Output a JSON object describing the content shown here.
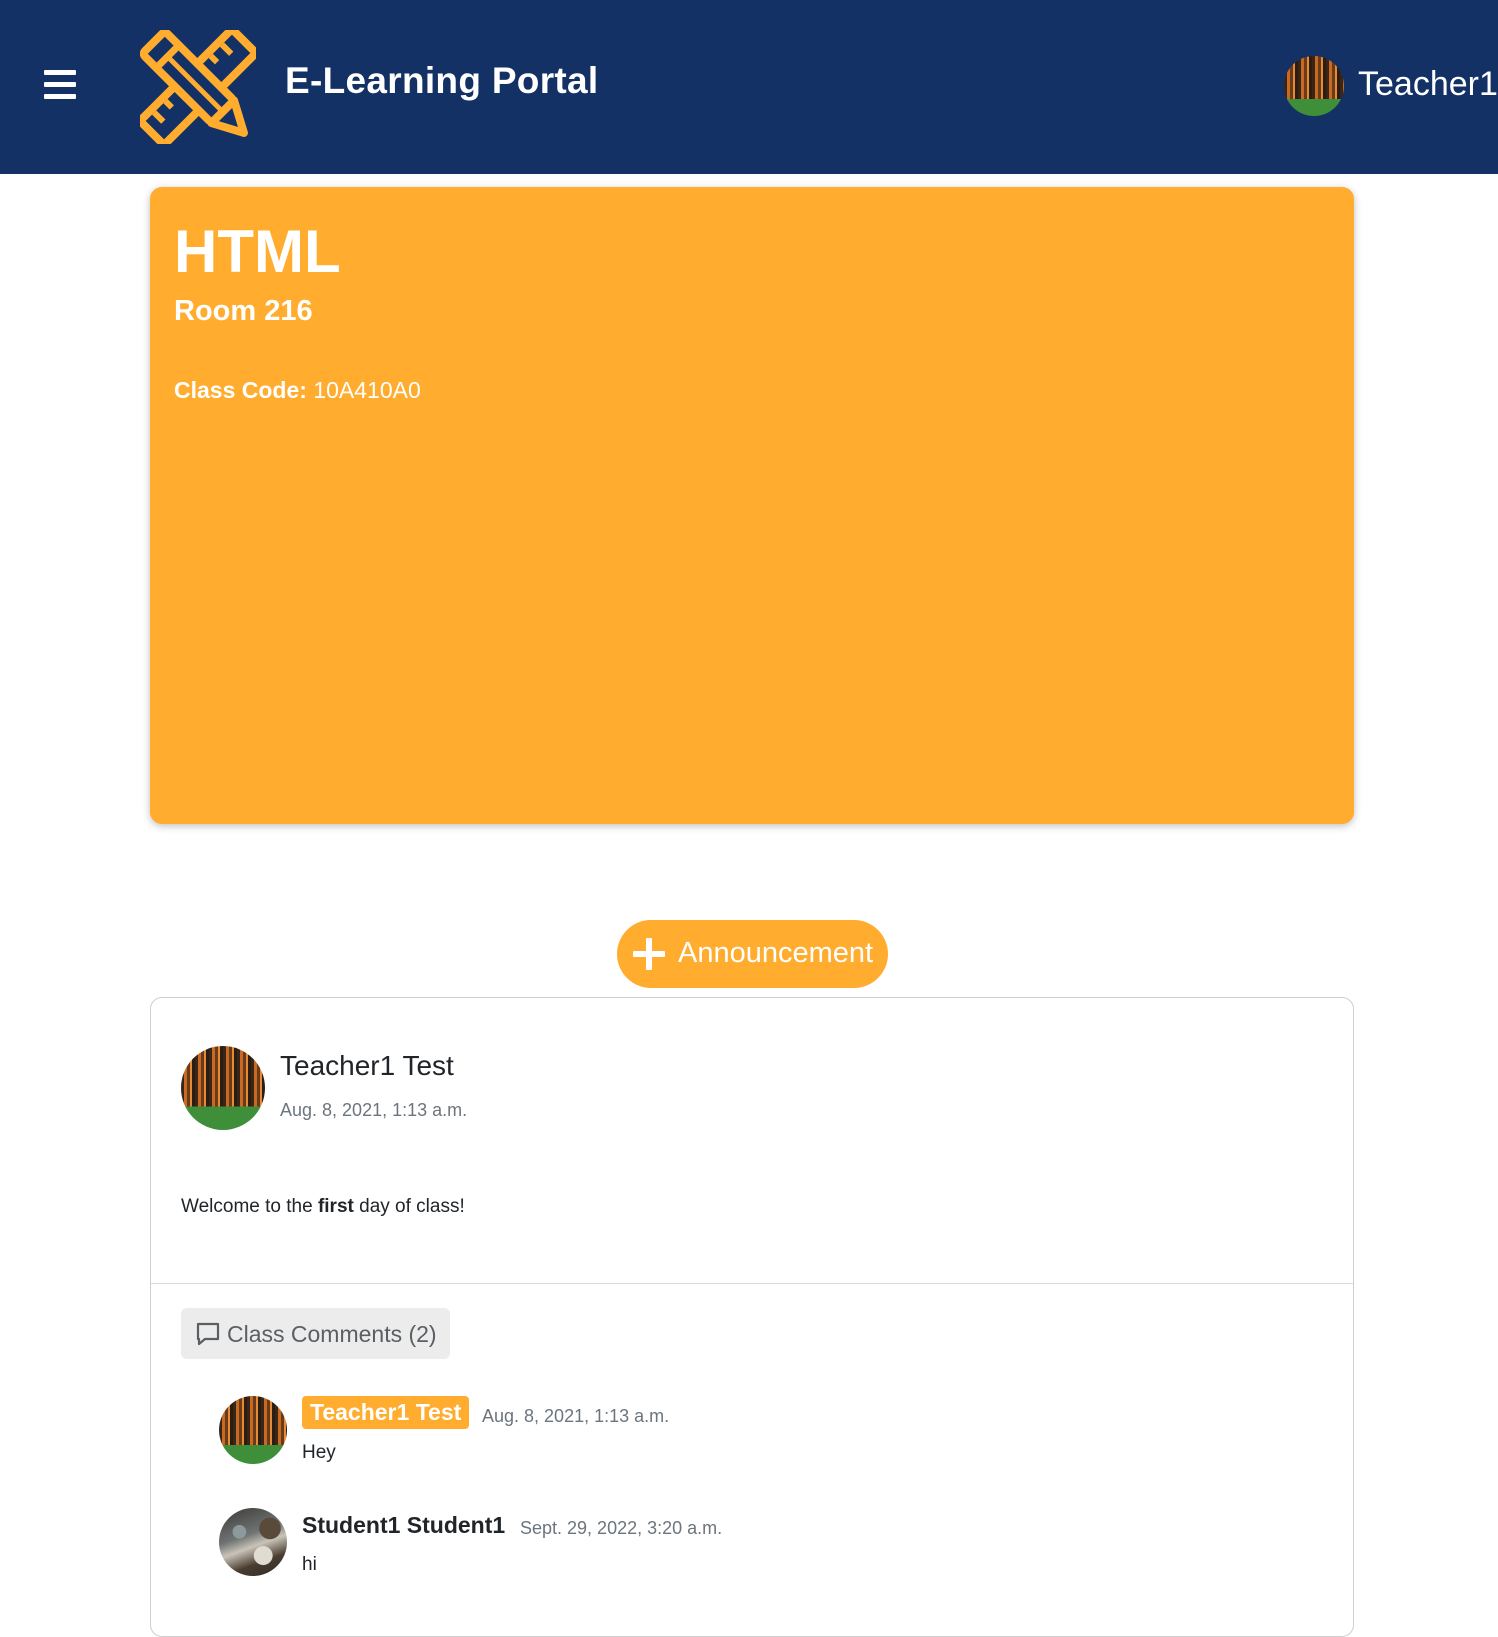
{
  "header": {
    "brand": "E-Learning Portal",
    "user_name": "Teacher1",
    "menu_icon": "hamburger-menu-icon",
    "logo_icon": "pencil-ruler-icon",
    "background_color": "#143166",
    "logo_color": "#ffac2f"
  },
  "class": {
    "name": "HTML",
    "room": "Room 216",
    "code_label": "Class Code:",
    "code_value": "10A410A0",
    "banner_color": "#ffac2f"
  },
  "announcement_button": {
    "icon": "plus-icon",
    "label": "Announcement"
  },
  "post": {
    "author": "Teacher1 Test",
    "date": "Aug. 8, 2021, 1:13 a.m.",
    "body_before": "Welcome to the ",
    "body_bold": "first",
    "body_after": " day of class!",
    "comments_toggle_label": "Class Comments (2)",
    "comments_icon": "speech-bubble-icon",
    "comments": [
      {
        "author": "Teacher1 Test",
        "date": "Aug. 8, 2021, 1:13 a.m.",
        "text": "Hey"
      },
      {
        "author": "Student1 Student1",
        "date": "Sept. 29, 2022, 3:20 a.m.",
        "text": "hi"
      }
    ]
  }
}
